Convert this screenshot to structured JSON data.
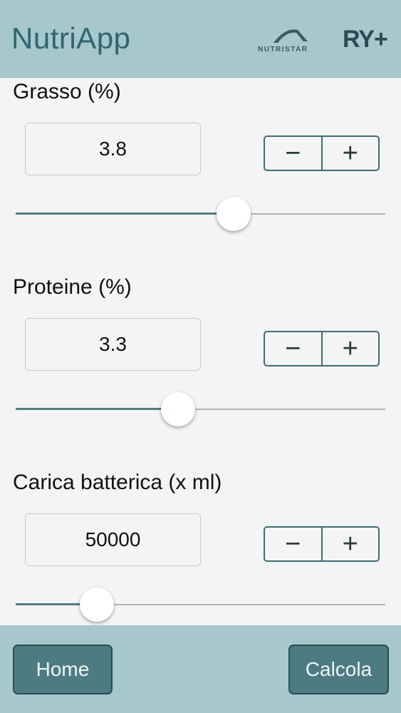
{
  "app": {
    "title": "NutriApp"
  },
  "logos": {
    "nutristar": "NUTRISTAR",
    "ry": "RY+"
  },
  "fields": [
    {
      "label": "Grasso (%)",
      "value": "3.8",
      "slider_fraction": 0.59
    },
    {
      "label": "Proteine (%)",
      "value": "3.3",
      "slider_fraction": 0.44
    },
    {
      "label": "Carica batterica (x ml)",
      "value": "50000",
      "slider_fraction": 0.22
    }
  ],
  "stepper": {
    "minus": "−",
    "plus": "+"
  },
  "footer": {
    "home_label": "Home",
    "calcola_label": "Calcola"
  },
  "colors": {
    "accent": "#4e7b82",
    "background": "#a6c7cb",
    "panel": "#f4f4f4"
  }
}
